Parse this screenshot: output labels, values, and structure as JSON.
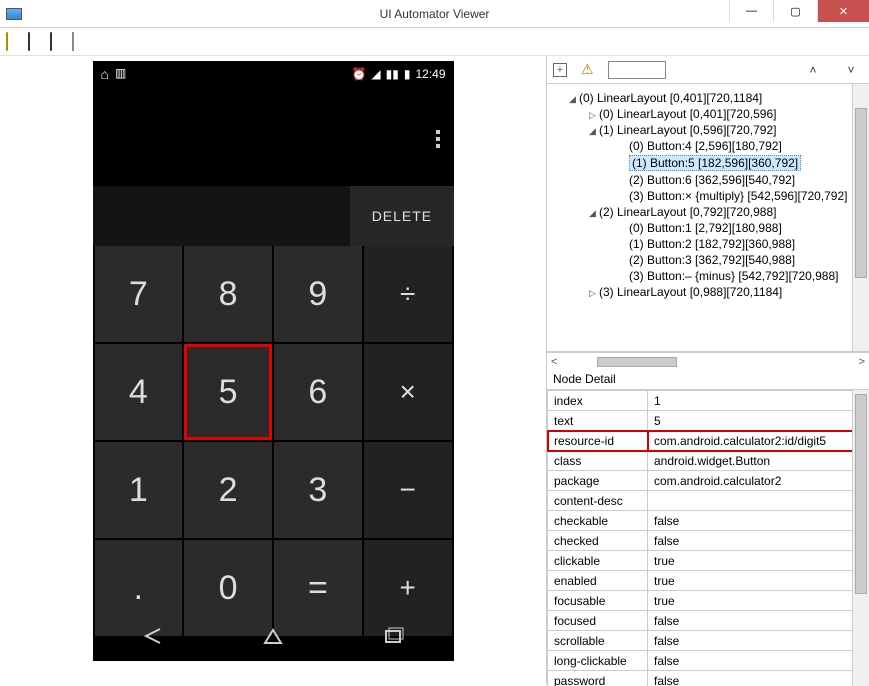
{
  "window": {
    "title": "UI Automator Viewer",
    "minimize": "—",
    "maximize": "▢",
    "close": "✕"
  },
  "device": {
    "time": "12:49",
    "delete_label": "DELETE",
    "keys": {
      "r1": [
        "7",
        "8",
        "9",
        "÷"
      ],
      "r2": [
        "4",
        "5",
        "6",
        "×"
      ],
      "r3": [
        "1",
        "2",
        "3",
        "−"
      ],
      "r4": [
        ".",
        "0",
        "=",
        "+"
      ]
    }
  },
  "tree": {
    "n0": "(0) LinearLayout [0,401][720,1184]",
    "n1": "(0) LinearLayout [0,401][720,596]",
    "n2": "(1) LinearLayout [0,596][720,792]",
    "n3": "(0) Button:4 [2,596][180,792]",
    "n4": "(1) Button:5 [182,596][360,792]",
    "n5": "(2) Button:6 [362,596][540,792]",
    "n6": "(3) Button:× {multiply} [542,596][720,792]",
    "n7": "(2) LinearLayout [0,792][720,988]",
    "n8": "(0) Button:1 [2,792][180,988]",
    "n9": "(1) Button:2 [182,792][360,988]",
    "n10": "(2) Button:3 [362,792][540,988]",
    "n11": "(3) Button:– {minus} [542,792][720,988]",
    "n12": "(3) LinearLayout [0,988][720,1184]"
  },
  "scroll": {
    "left": "<",
    "right": ">"
  },
  "detail_header": "Node Detail",
  "detail": {
    "rows": [
      {
        "k": "index",
        "v": "1"
      },
      {
        "k": "text",
        "v": "5"
      },
      {
        "k": "resource-id",
        "v": "com.android.calculator2:id/digit5",
        "hi": true
      },
      {
        "k": "class",
        "v": "android.widget.Button"
      },
      {
        "k": "package",
        "v": "com.android.calculator2"
      },
      {
        "k": "content-desc",
        "v": ""
      },
      {
        "k": "checkable",
        "v": "false"
      },
      {
        "k": "checked",
        "v": "false"
      },
      {
        "k": "clickable",
        "v": "true"
      },
      {
        "k": "enabled",
        "v": "true"
      },
      {
        "k": "focusable",
        "v": "true"
      },
      {
        "k": "focused",
        "v": "false"
      },
      {
        "k": "scrollable",
        "v": "false"
      },
      {
        "k": "long-clickable",
        "v": "false"
      },
      {
        "k": "password",
        "v": "false"
      }
    ]
  },
  "nav_arrows": {
    "up": "˄",
    "down": "˅"
  }
}
